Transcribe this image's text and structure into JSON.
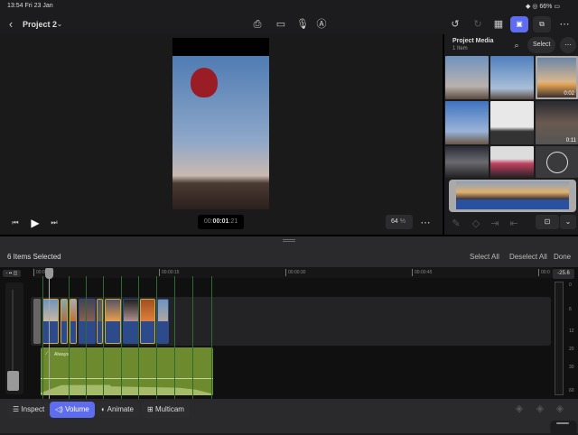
{
  "status": {
    "time": "13:54",
    "date": "Fri 23 Jan",
    "battery": "66%"
  },
  "toolbar": {
    "project": "Project 2"
  },
  "viewer": {
    "timecode_dim": "00:",
    "timecode_main": "00:01",
    "timecode_frames": ":21",
    "zoom": "64",
    "zoom_unit": "%"
  },
  "media": {
    "title": "Project Media",
    "count": "1 Item",
    "select": "Select",
    "durations": [
      "0:02",
      "0:11"
    ]
  },
  "selection": {
    "label": "6 Items Selected",
    "select_all": "Select All",
    "deselect_all": "Deselect All",
    "done": "Done"
  },
  "ruler": [
    "00:00:00",
    "00:00:15",
    "00:00:30",
    "00:00:45",
    "00:0"
  ],
  "audio": {
    "keyframe_label": "Always",
    "meter_value": "-25.6",
    "meter_scale": [
      "0",
      "6",
      "12",
      "20",
      "30",
      "60"
    ]
  },
  "bottom": {
    "inspect": "Inspect",
    "volume": "Volume",
    "animate": "Animate",
    "multicam": "Multicam"
  },
  "colors": {
    "accent": "#5e6cf0",
    "audio_clip": "#6d8a2e"
  }
}
